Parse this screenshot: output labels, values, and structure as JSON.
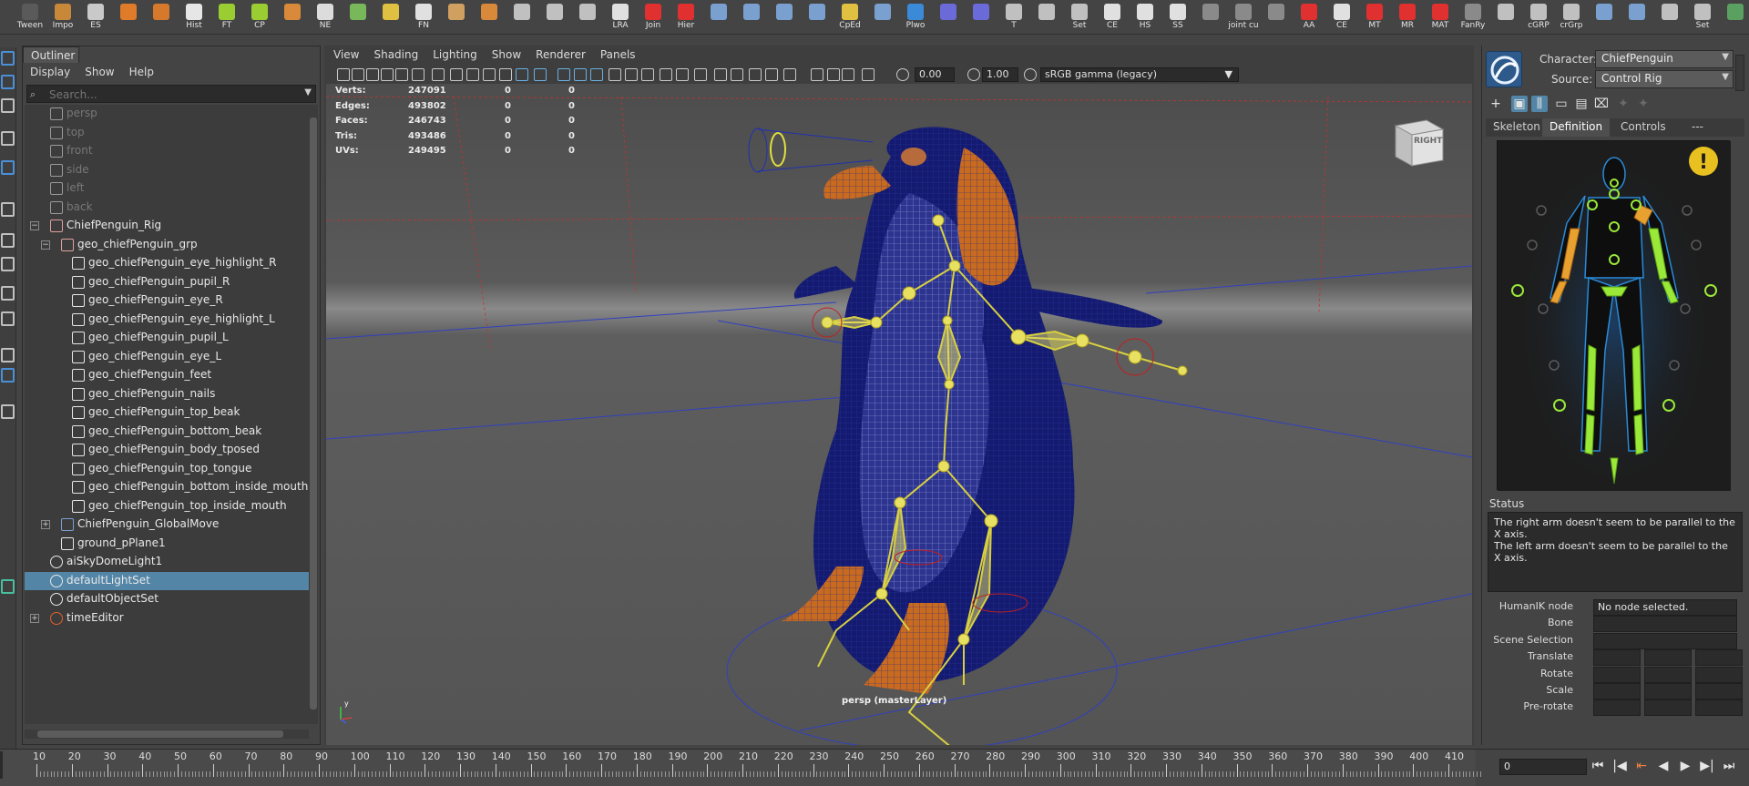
{
  "shelf": {
    "items": [
      {
        "label": "Tween",
        "color": "#5a5a5a"
      },
      {
        "label": "Impo",
        "color": "#c8883a"
      },
      {
        "label": "ES",
        "color": "#c9c9c9"
      },
      {
        "label": "",
        "color": "#e07b2a"
      },
      {
        "label": "",
        "color": "#d6792d"
      },
      {
        "label": "Hist",
        "color": "#e6e6e6"
      },
      {
        "label": "FT",
        "color": "#9acd32"
      },
      {
        "label": "CP",
        "color": "#9acd32"
      },
      {
        "label": "",
        "color": "#d8893a"
      },
      {
        "label": "NE",
        "color": "#dcdcdc"
      },
      {
        "label": "",
        "color": "#78b85a"
      },
      {
        "label": "",
        "color": "#e0c040"
      },
      {
        "label": "FN",
        "color": "#e0e0e0"
      },
      {
        "label": "",
        "color": "#d0a060"
      },
      {
        "label": "",
        "color": "#d8893a"
      },
      {
        "label": "",
        "color": "#c0c0c0"
      },
      {
        "label": "",
        "color": "#c0c0c0"
      },
      {
        "label": "",
        "color": "#c0c0c0"
      },
      {
        "label": "LRA",
        "color": "#e0e0e0"
      },
      {
        "label": "Join",
        "color": "#e03030"
      },
      {
        "label": "Hier",
        "color": "#e03030"
      },
      {
        "label": "",
        "color": "#7aa0d0"
      },
      {
        "label": "",
        "color": "#7aa0d0"
      },
      {
        "label": "",
        "color": "#7aa0d0"
      },
      {
        "label": "",
        "color": "#7aa0d0"
      },
      {
        "label": "CpEd",
        "color": "#e0c040"
      },
      {
        "label": "",
        "color": "#7aa0d0"
      },
      {
        "label": "Plwo",
        "color": "#3a8ad8"
      },
      {
        "label": "",
        "color": "#6a6ad8"
      },
      {
        "label": "",
        "color": "#6a6ad8"
      },
      {
        "label": "T",
        "color": "#c0c0c0"
      },
      {
        "label": "",
        "color": "#c0c0c0"
      },
      {
        "label": "Set",
        "color": "#c0c0c0"
      },
      {
        "label": "CE",
        "color": "#e0e0e0"
      },
      {
        "label": "HS",
        "color": "#e0e0e0"
      },
      {
        "label": "SS",
        "color": "#e0e0e0"
      },
      {
        "label": "",
        "color": "#8a8a8a"
      },
      {
        "label": "joint cu",
        "color": "#8a8a8a"
      },
      {
        "label": "",
        "color": "#8a8a8a"
      },
      {
        "label": "AA",
        "color": "#e03030"
      },
      {
        "label": "CE",
        "color": "#e0e0e0"
      },
      {
        "label": "MT",
        "color": "#e03030"
      },
      {
        "label": "MR",
        "color": "#e03030"
      },
      {
        "label": "MAT",
        "color": "#e03030"
      },
      {
        "label": "FanRy",
        "color": "#8a8a8a"
      },
      {
        "label": "",
        "color": "#c0c0c0"
      },
      {
        "label": "cGRP",
        "color": "#c0c0c0"
      },
      {
        "label": "crGrp",
        "color": "#c0c0c0"
      },
      {
        "label": "",
        "color": "#7aa0d0"
      },
      {
        "label": "",
        "color": "#7aa0d0"
      },
      {
        "label": "",
        "color": "#c0c0c0"
      },
      {
        "label": "Set",
        "color": "#c0c0c0"
      },
      {
        "label": "",
        "color": "#5aa060"
      }
    ]
  },
  "outliner": {
    "tab": "Outliner",
    "menu": [
      "Display",
      "Show",
      "Help"
    ],
    "search_placeholder": "Search...",
    "rows": [
      {
        "indent": 1,
        "icon": "camera",
        "label": "persp",
        "dim": true,
        "expand": ""
      },
      {
        "indent": 1,
        "icon": "camera",
        "label": "top",
        "dim": true,
        "expand": ""
      },
      {
        "indent": 1,
        "icon": "camera",
        "label": "front",
        "dim": true,
        "expand": ""
      },
      {
        "indent": 1,
        "icon": "camera",
        "label": "side",
        "dim": true,
        "expand": ""
      },
      {
        "indent": 1,
        "icon": "camera",
        "label": "left",
        "dim": true,
        "expand": ""
      },
      {
        "indent": 1,
        "icon": "camera",
        "label": "back",
        "dim": true,
        "expand": ""
      },
      {
        "indent": 1,
        "icon": "rig",
        "label": "ChiefPenguin_Rig",
        "dim": false,
        "expand": "−"
      },
      {
        "indent": 2,
        "icon": "rig",
        "label": "geo_chiefPenguin_grp",
        "dim": false,
        "expand": "−"
      },
      {
        "indent": 3,
        "icon": "mesh",
        "label": "geo_chiefPenguin_eye_highlight_R",
        "dim": false,
        "expand": ""
      },
      {
        "indent": 3,
        "icon": "mesh",
        "label": "geo_chiefPenguin_pupil_R",
        "dim": false,
        "expand": ""
      },
      {
        "indent": 3,
        "icon": "mesh",
        "label": "geo_chiefPenguin_eye_R",
        "dim": false,
        "expand": ""
      },
      {
        "indent": 3,
        "icon": "mesh",
        "label": "geo_chiefPenguin_eye_highlight_L",
        "dim": false,
        "expand": ""
      },
      {
        "indent": 3,
        "icon": "mesh",
        "label": "geo_chiefPenguin_pupil_L",
        "dim": false,
        "expand": ""
      },
      {
        "indent": 3,
        "icon": "mesh",
        "label": "geo_chiefPenguin_eye_L",
        "dim": false,
        "expand": ""
      },
      {
        "indent": 3,
        "icon": "mesh",
        "label": "geo_chiefPenguin_feet",
        "dim": false,
        "expand": ""
      },
      {
        "indent": 3,
        "icon": "mesh",
        "label": "geo_chiefPenguin_nails",
        "dim": false,
        "expand": ""
      },
      {
        "indent": 3,
        "icon": "mesh",
        "label": "geo_chiefPenguin_top_beak",
        "dim": false,
        "expand": ""
      },
      {
        "indent": 3,
        "icon": "mesh",
        "label": "geo_chiefPenguin_bottom_beak",
        "dim": false,
        "expand": ""
      },
      {
        "indent": 3,
        "icon": "mesh",
        "label": "geo_chiefPenguin_body_tposed",
        "dim": false,
        "expand": ""
      },
      {
        "indent": 3,
        "icon": "mesh",
        "label": "geo_chiefPenguin_top_tongue",
        "dim": false,
        "expand": ""
      },
      {
        "indent": 3,
        "icon": "mesh",
        "label": "geo_chiefPenguin_bottom_inside_mouth",
        "dim": false,
        "expand": ""
      },
      {
        "indent": 3,
        "icon": "mesh",
        "label": "geo_chiefPenguin_top_inside_mouth",
        "dim": false,
        "expand": ""
      },
      {
        "indent": 2,
        "icon": "curve",
        "label": "ChiefPenguin_GlobalMove",
        "dim": false,
        "expand": "+"
      },
      {
        "indent": 2,
        "icon": "mesh",
        "label": "ground_pPlane1",
        "dim": false,
        "expand": ""
      },
      {
        "indent": 1,
        "icon": "light",
        "label": "aiSkyDomeLight1",
        "dim": false,
        "expand": ""
      },
      {
        "indent": 1,
        "icon": "set",
        "label": "defaultLightSet",
        "dim": false,
        "expand": "",
        "selected": true
      },
      {
        "indent": 1,
        "icon": "set",
        "label": "defaultObjectSet",
        "dim": false,
        "expand": ""
      },
      {
        "indent": 1,
        "icon": "clock",
        "label": "timeEditor",
        "dim": false,
        "expand": "+"
      }
    ]
  },
  "viewport": {
    "menu": [
      "View",
      "Shading",
      "Lighting",
      "Show",
      "Renderer",
      "Panels"
    ],
    "exposure": "0.00",
    "gamma": "1.00",
    "colorspace": "sRGB gamma (legacy)",
    "hud": [
      {
        "label": "Verts:",
        "v1": "247091",
        "v2": "0",
        "v3": "0"
      },
      {
        "label": "Edges:",
        "v1": "493802",
        "v2": "0",
        "v3": "0"
      },
      {
        "label": "Faces:",
        "v1": "246743",
        "v2": "0",
        "v3": "0"
      },
      {
        "label": "Tris:",
        "v1": "493486",
        "v2": "0",
        "v3": "0"
      },
      {
        "label": "UVs:",
        "v1": "249495",
        "v2": "0",
        "v3": "0"
      }
    ],
    "camera_label": "persp (masterLayer)",
    "viewcube_label": "RIGHT",
    "axis": {
      "y": "y",
      "x": "x",
      "z": "z"
    }
  },
  "hik": {
    "character_label": "Character:",
    "character_value": "ChiefPenguin",
    "source_label": "Source:",
    "source_value": "Control Rig",
    "tabs": [
      "Skeleton",
      "Definition",
      "Controls",
      "---"
    ],
    "active_tab": "Definition",
    "status_title": "Status",
    "status_lines": [
      "The right arm doesn't seem to be parallel to the X axis.",
      "The left arm doesn't seem to be parallel to the X axis."
    ],
    "props": [
      {
        "label": "HumanIK node",
        "value": "No node selected."
      },
      {
        "label": "Bone",
        "value": ""
      },
      {
        "label": "Scene Selection",
        "value": ""
      },
      {
        "label": "Translate",
        "value": ""
      },
      {
        "label": "Rotate",
        "value": ""
      },
      {
        "label": "Scale",
        "value": ""
      },
      {
        "label": "Pre-rotate",
        "value": ""
      }
    ]
  },
  "timeslider": {
    "ticks": [
      "10",
      "20",
      "30",
      "40",
      "50",
      "60",
      "70",
      "80",
      "90",
      "100",
      "110",
      "120",
      "130",
      "140",
      "150",
      "160",
      "170",
      "180",
      "190",
      "200",
      "210",
      "220",
      "230",
      "240",
      "250",
      "260",
      "270",
      "280",
      "290",
      "300",
      "310",
      "320",
      "330",
      "340",
      "350",
      "360",
      "370",
      "380",
      "390",
      "400",
      "410"
    ],
    "current_frame": "0",
    "controls": [
      "⏮",
      "|◀",
      "⇤",
      "◀",
      "▶",
      "▶|",
      "⏭"
    ]
  }
}
